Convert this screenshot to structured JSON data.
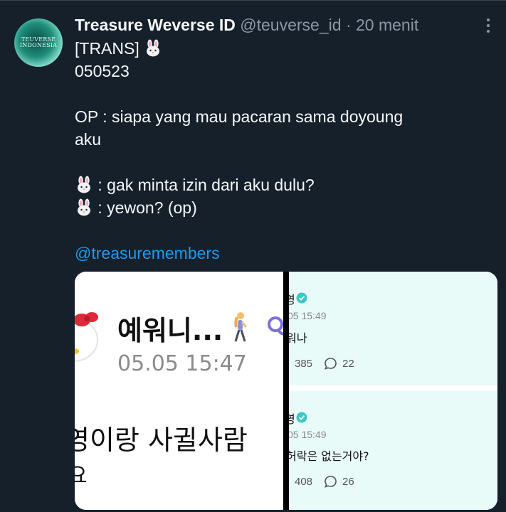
{
  "tweet": {
    "author_name": "Treasure Weverse ID",
    "handle": "@teuverse_id",
    "separator": "·",
    "time_ago": "20 menit",
    "avatar_text": "TEUVERSE INDONESIA",
    "lines": {
      "l1": "[TRANS] ",
      "l2": "050523",
      "l4": "OP : siapa yang mau pacaran sama doyoung",
      "l5": "aku",
      "l7": " : gak minta izin dari aku dulu?",
      "l8": " : yewon? (op)",
      "mention": "@treasuremembers"
    },
    "emoji_icon": "rabbit-face-icon"
  },
  "media": {
    "left": {
      "user": "예워니...",
      "time": "05.05 15:47",
      "text": "영이랑 사귈사람",
      "text2": "요"
    },
    "right": {
      "top": {
        "name": "영",
        "time": "05 15:49",
        "text": "워나",
        "likes": "385",
        "comments": "22"
      },
      "bottom": {
        "name": "영",
        "time": "05 15:49",
        "text": "허락은 없는거야?",
        "likes": "408",
        "comments": "26"
      }
    }
  },
  "colors": {
    "background": "#15202b",
    "text": "#f7f9f9",
    "muted": "#8b98a5",
    "link": "#1d9bf0",
    "card_mint": "#e8fbf8",
    "verified": "#3ec6c6"
  }
}
